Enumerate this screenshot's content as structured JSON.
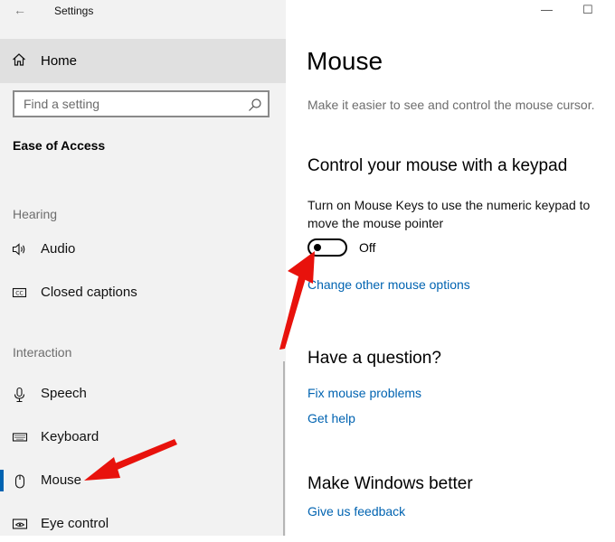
{
  "window": {
    "app_title": "Settings",
    "minimize_glyph": "—",
    "maximize_glyph": "☐"
  },
  "sidebar": {
    "home": {
      "label": "Home",
      "icon": "home-icon"
    },
    "search": {
      "placeholder": "Find a setting",
      "icon": "search-icon"
    },
    "category": "Ease of Access",
    "groups": [
      {
        "label": "Hearing",
        "items": [
          {
            "label": "Audio",
            "icon": "speaker-icon"
          },
          {
            "label": "Closed captions",
            "icon": "cc-icon"
          }
        ]
      },
      {
        "label": "Interaction",
        "items": [
          {
            "label": "Speech",
            "icon": "microphone-icon"
          },
          {
            "label": "Keyboard",
            "icon": "keyboard-icon"
          },
          {
            "label": "Mouse",
            "icon": "mouse-icon",
            "selected": true
          },
          {
            "label": "Eye control",
            "icon": "eye-control-icon"
          }
        ]
      }
    ]
  },
  "main": {
    "title": "Mouse",
    "description": "Make it easier to see and control the mouse cursor.",
    "keypad_section": {
      "heading": "Control your mouse with a keypad",
      "setting_text": "Turn on Mouse Keys to use the numeric keypad to move the mouse pointer",
      "toggle_state": "Off",
      "link": "Change other mouse options"
    },
    "question_section": {
      "heading": "Have a question?",
      "links": [
        "Fix mouse problems",
        "Get help"
      ]
    },
    "feedback_section": {
      "heading": "Make Windows better",
      "link": "Give us feedback"
    }
  },
  "colors": {
    "accent": "#0063b1",
    "annotation_arrow": "#e8120c",
    "sidebar_bg": "#f2f2f2"
  }
}
